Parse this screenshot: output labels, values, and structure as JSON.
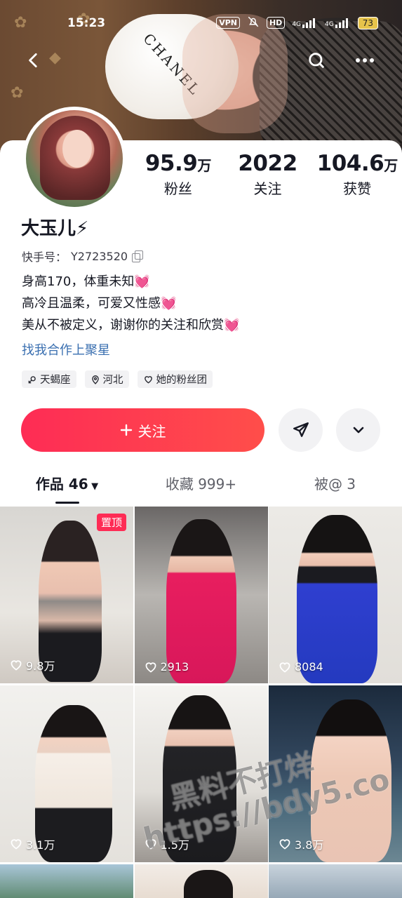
{
  "status_bar": {
    "time": "15:23",
    "vpn": "VPN",
    "hd": "HD",
    "net1": "4G",
    "net2": "4G",
    "battery": "73"
  },
  "profile": {
    "name": "大玉儿⚡",
    "kuaishou_id_label": "快手号：",
    "kuaishou_id": "Y2723520",
    "stats": [
      {
        "number": "95.9",
        "unit": "万",
        "label": "粉丝"
      },
      {
        "number": "2022",
        "unit": "",
        "label": "关注"
      },
      {
        "number": "104.6",
        "unit": "万",
        "label": "获赞"
      }
    ],
    "bio": [
      "身高170，体重未知💓",
      "高冷且温柔，可爱又性感💓",
      "美从不被定义，谢谢你的关注和欣赏💓"
    ],
    "link_text": "找我合作上聚星",
    "tags": [
      "天蝎座",
      "河北",
      "她的粉丝团"
    ]
  },
  "actions": {
    "follow_label": "关注",
    "follow_icon": "plus-icon",
    "share_icon": "send-icon",
    "more_icon": "chevron-down-icon"
  },
  "tabs": [
    {
      "label": "作品 46",
      "active": true
    },
    {
      "label": "收藏 999+",
      "active": false
    },
    {
      "label": "被@ 3",
      "active": false
    }
  ],
  "videos": [
    {
      "likes": "9.8万",
      "pinned_label": "置顶"
    },
    {
      "likes": "2913"
    },
    {
      "likes": "8084"
    },
    {
      "likes": "3.1万"
    },
    {
      "likes": "1.5万"
    },
    {
      "likes": "3.8万"
    }
  ],
  "watermark": {
    "line1": "黑料不打烊",
    "line2": "https://bdy5.co"
  },
  "colors": {
    "accent": "#fe2c55",
    "link": "#3a6fb0"
  }
}
